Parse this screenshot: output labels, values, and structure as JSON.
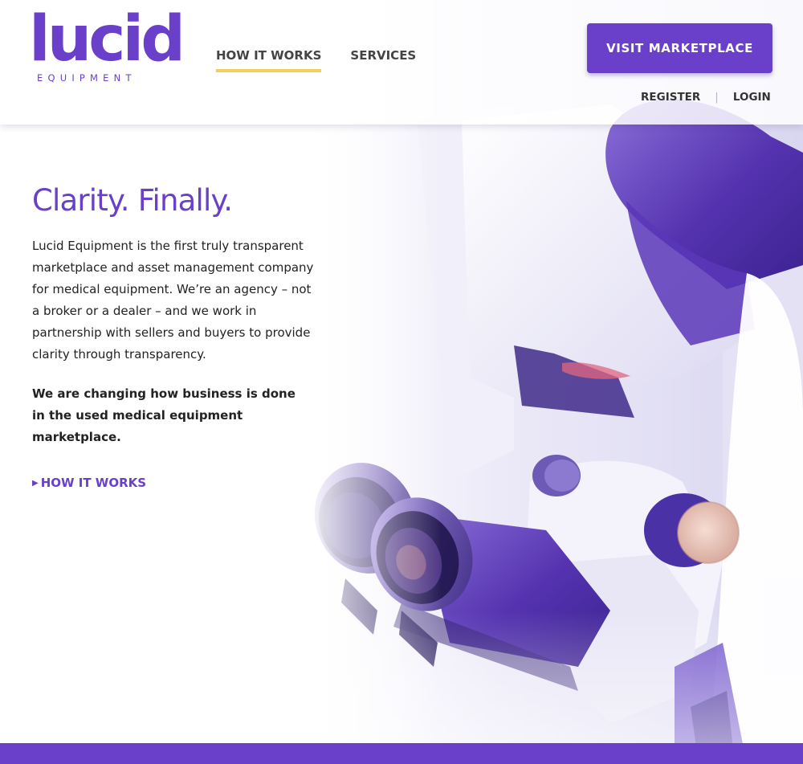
{
  "brand": {
    "logo_word": "lucid",
    "logo_sub": "EQUIPMENT",
    "accent": "#6a3fc9",
    "underline": "#f5cf5a"
  },
  "nav": {
    "items": [
      {
        "label": "HOW IT WORKS",
        "active": true
      },
      {
        "label": "SERVICES",
        "active": false
      }
    ]
  },
  "header": {
    "cta_label": "VISIT MARKETPLACE",
    "register_label": "REGISTER",
    "separator": "|",
    "login_label": "LOGIN"
  },
  "hero": {
    "title": "Clarity. Finally.",
    "body": "Lucid Equipment is the first truly transparent marketplace and asset management company for medical equipment. We’re an agency – not a broker or a dealer – and we work in partnership with sellers and buyers to provide clarity through transparency.",
    "strong": "We are changing how business is done in the used medical equipment marketplace.",
    "link_icon": "caret-right-icon",
    "link_label": "HOW IT WORKS"
  }
}
